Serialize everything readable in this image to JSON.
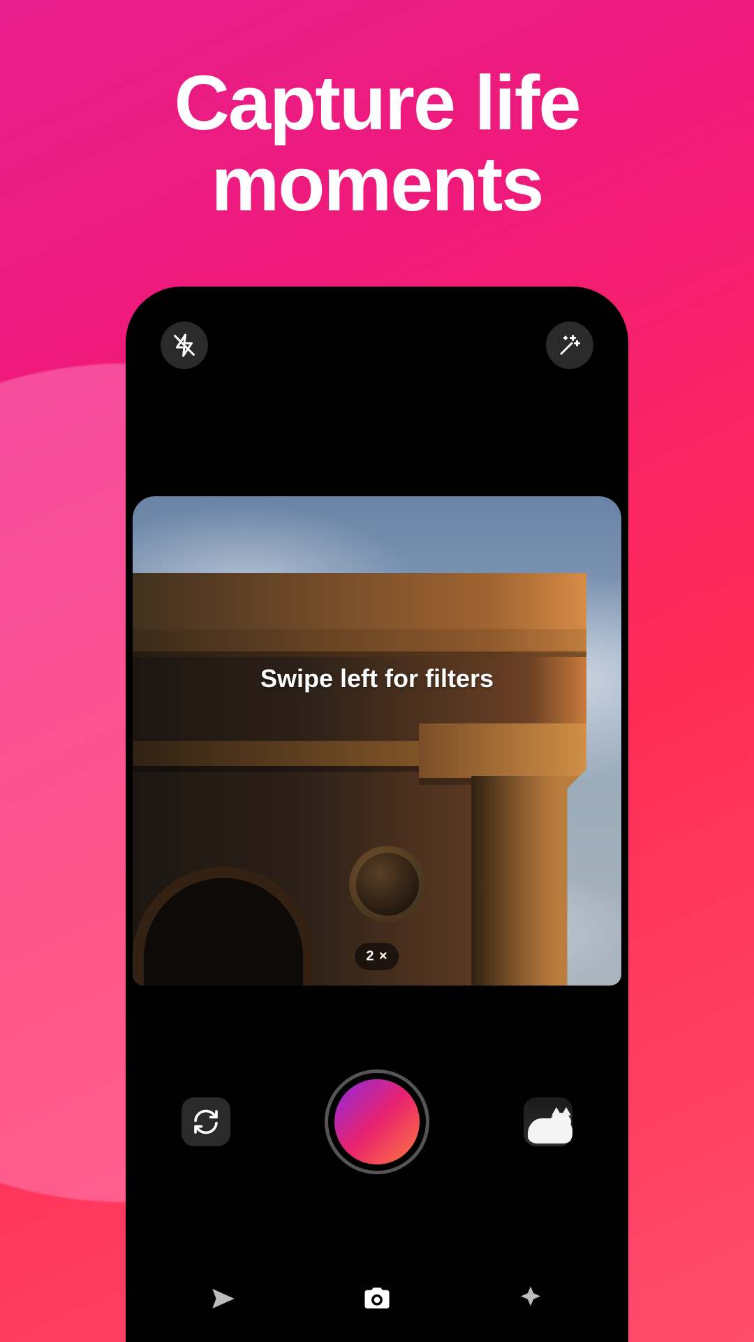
{
  "marketing": {
    "headline": "Capture life moments"
  },
  "camera": {
    "viewfinder_hint": "Swipe left for filters",
    "zoom_label": "2 ×",
    "icons": {
      "flash_off": "flash-off-icon",
      "magic": "magic-wand-icon",
      "swap": "camera-swap-icon",
      "shutter": "shutter-button",
      "gallery": "gallery-thumbnail"
    }
  },
  "bottom_nav": {
    "items": [
      {
        "name": "send-icon",
        "active": false
      },
      {
        "name": "camera-icon",
        "active": true
      },
      {
        "name": "sparkle-icon",
        "active": false
      }
    ]
  },
  "colors": {
    "gradient_start": "#8a2be2",
    "gradient_mid": "#e9226f",
    "gradient_end": "#ff7a3c"
  }
}
